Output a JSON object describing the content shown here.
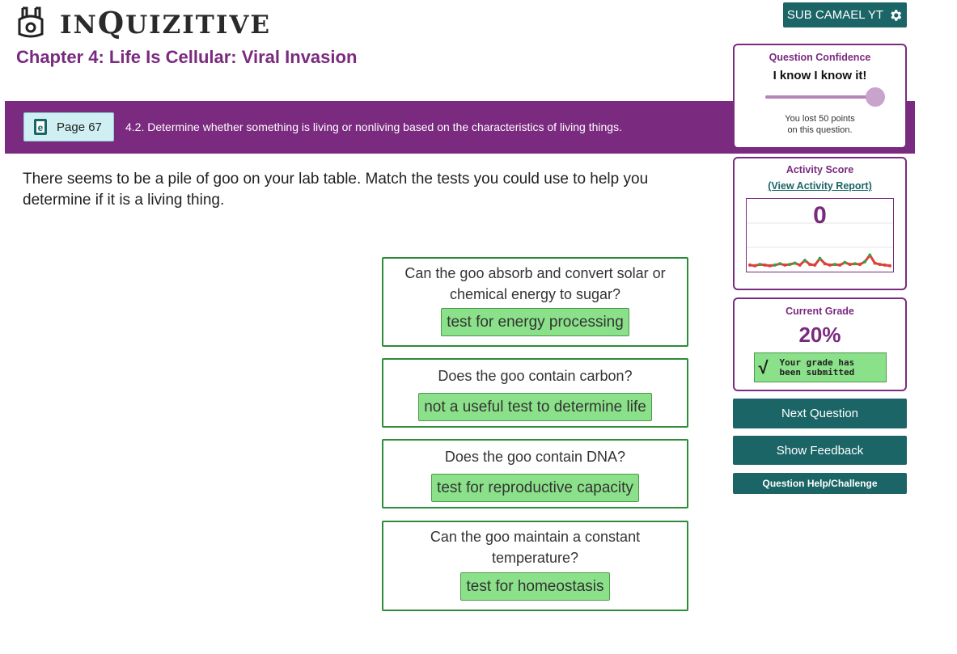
{
  "header": {
    "logo_text_1": "I",
    "logo_text_2": "N",
    "logo_text_3": "Q",
    "logo_text_4": "UIZITIVE",
    "user_label": "SUB CAMAEL YT"
  },
  "chapter_title": "Chapter 4: Life Is Cellular: Viral Invasion",
  "ebook": {
    "label": "Page 67"
  },
  "objective": "4.2. Determine whether something is living or nonliving based on the characteristics of living things.",
  "question": "There seems to be a pile of goo on your lab table. Match the tests you could use to help you determine if it is a living thing.",
  "matches": [
    {
      "prompt": "Can the goo absorb and convert solar or chemical energy to sugar?",
      "answer": "test for energy processing"
    },
    {
      "prompt": "Does the goo contain carbon?",
      "answer": "not a useful test to determine life"
    },
    {
      "prompt": "Does the goo contain DNA?",
      "answer": "test for reproductive capacity"
    },
    {
      "prompt": "Can the goo maintain a constant temperature?",
      "answer": "test for homeostasis"
    }
  ],
  "confidence": {
    "title": "Question Confidence",
    "value": "I know I know it!",
    "level": 1.0,
    "lost_line1": "You lost 50 points",
    "lost_line2": "on this question."
  },
  "activity": {
    "title": "Activity Score",
    "link": "(View Activity Report)",
    "score": "0",
    "sparkline": [
      0.05,
      0.04,
      0.06,
      0.05,
      0.04,
      0.05,
      0.07,
      0.05,
      0.06,
      0.08,
      0.05,
      0.12,
      0.06,
      0.05,
      0.15,
      0.07,
      0.05,
      0.06,
      0.05,
      0.09,
      0.06,
      0.07,
      0.06,
      0.1,
      0.2,
      0.08,
      0.06,
      0.05,
      0.04
    ],
    "colors": {
      "line": "#d9443a",
      "up": "#2fa84a"
    }
  },
  "grade": {
    "title": "Current Grade",
    "value": "20%",
    "submitted_line1": "Your grade has",
    "submitted_line2": "been submitted"
  },
  "buttons": {
    "next": "Next Question",
    "feedback": "Show Feedback",
    "help": "Question Help/Challenge"
  },
  "colors": {
    "brand_purple": "#7a2a7f",
    "teal": "#1b6566",
    "match_green": "#8be18a"
  }
}
